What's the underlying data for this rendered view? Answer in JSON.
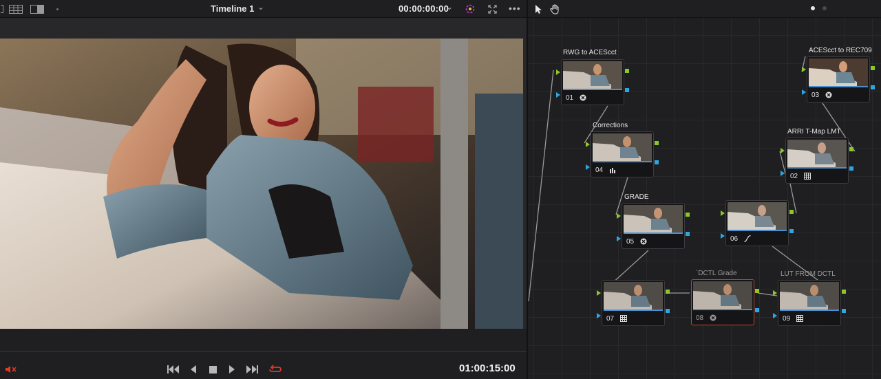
{
  "viewer": {
    "timeline_name": "Timeline 1",
    "source_timecode": "00:00:00:00",
    "record_timecode": "01:00:15:00"
  },
  "nodes": [
    {
      "number": "01",
      "label": "RWG to ACEScct",
      "icon": "lut-circle-icon",
      "selected": false
    },
    {
      "number": "02",
      "label": "ARRI T-Map LMT",
      "icon": "grid-icon",
      "selected": false
    },
    {
      "number": "03",
      "label": "ACEScct to REC709",
      "icon": "lut-circle-icon",
      "selected": false
    },
    {
      "number": "04",
      "label": "Corrections",
      "icon": "bars-icon",
      "selected": false
    },
    {
      "number": "05",
      "label": "GRADE",
      "icon": "lut-circle-icon",
      "selected": false
    },
    {
      "number": "06",
      "label": "",
      "icon": "curve-icon",
      "selected": false
    },
    {
      "number": "07",
      "label": "",
      "icon": "grid-icon",
      "selected": false
    },
    {
      "number": "08",
      "label": "`DCTL Grade",
      "icon": "disabled-circle-icon",
      "selected": true
    },
    {
      "number": "09",
      "label": "LUT FROM DCTL",
      "icon": "grid-icon",
      "selected": false
    }
  ],
  "colors": {
    "accent_red": "#e03a2a",
    "selected_node": "#c8452c",
    "rgb_input": "#8ac926",
    "alpha_input": "#2ea7e0",
    "node_bar": "#4a8fcf"
  }
}
